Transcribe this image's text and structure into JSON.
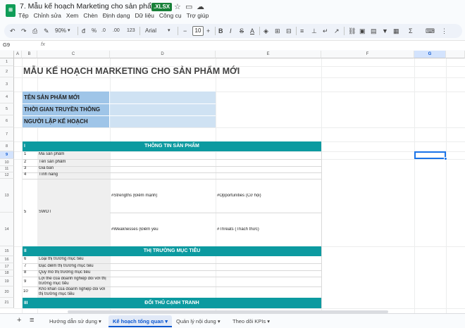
{
  "window": {
    "title": "7. Mẫu kế hoạch Marketing cho sản phẩm mới",
    "file_badge": ".XLSX",
    "menu": [
      "Tệp",
      "Chỉnh sửa",
      "Xem",
      "Chèn",
      "Định dạng",
      "Dữ liệu",
      "Công cụ",
      "Trợ giúp"
    ]
  },
  "toolbar": {
    "zoom": "90%",
    "percent": "%",
    "decimal_less": ".0",
    "decimal_more": ".00",
    "number_format": "123",
    "font_name": "Arial",
    "font_size": "10",
    "bold": "B",
    "italic": "I",
    "strike": "S",
    "text_color": "A"
  },
  "formula_bar": {
    "name_box": "G9",
    "fx": "fx"
  },
  "columns": [
    "A",
    "B",
    "C",
    "D",
    "E",
    "F",
    "G"
  ],
  "rows": [
    "1",
    "2",
    "3",
    "4",
    "5",
    "6",
    "7",
    "8",
    "9",
    "10",
    "11",
    "12",
    "13",
    "14",
    "15",
    "16",
    "17",
    "18",
    "19",
    "20",
    "21"
  ],
  "selected_cell": {
    "column": "G",
    "row": "9"
  },
  "sheet": {
    "main_title": "MẪU KẾ HOẠCH MARKETING CHO SẢN PHẨM MỚI",
    "info_labels": [
      "TÊN SẢN PHẨM MỚI",
      "THỜI GIAN TRUYỀN THÔNG",
      "NGƯỜI LẬP KẾ HOẠCH"
    ],
    "section1": {
      "index": "I",
      "header": "THÔNG TIN SẢN PHẨM",
      "items": [
        {
          "no": "1",
          "label": "Mã sản phẩm"
        },
        {
          "no": "2",
          "label": "Tên sản phẩm"
        },
        {
          "no": "3",
          "label": "Giá bán"
        },
        {
          "no": "4",
          "label": "Tính năng"
        },
        {
          "no": "5",
          "label": "SWOT"
        }
      ],
      "swot": {
        "strengths": "#Strengths (Điểm mạnh)",
        "opportunities": "#Opportunities (Cơ hội)",
        "weaknesses": "#Weaknesses (Điểm yếu",
        "threats": "#Threats (Thách thức)"
      }
    },
    "section2": {
      "index": "II",
      "header": "THỊ TRƯỜNG MỤC TIÊU",
      "items": [
        {
          "no": "6",
          "label": "Loại thị trường mục tiêu"
        },
        {
          "no": "7",
          "label": "Đặc điểm thị trường mục tiêu"
        },
        {
          "no": "8",
          "label": "Quy mô thị trường mục tiêu"
        },
        {
          "no": "9",
          "label": "Lợi thế của doanh nghiệp đối với thị trường mục tiêu"
        },
        {
          "no": "10",
          "label": "Khó khăn của doanh nghiệp đối với thị trường mục tiêu"
        }
      ]
    },
    "section3": {
      "index": "III",
      "header": "ĐỐI THỦ CẠNH TRANH"
    }
  },
  "sheet_tabs": [
    {
      "label": "Hướng dẫn sử dụng",
      "active": false
    },
    {
      "label": "Kế hoạch tổng quan",
      "active": true
    },
    {
      "label": "Quản lý nội dung",
      "active": false
    },
    {
      "label": "Theo dõi KPIs",
      "active": false
    }
  ],
  "colors": {
    "teal_header": "#0c9aa0",
    "info_label_bg": "#9fc5e8",
    "info_value_bg": "#cfe2f3",
    "selection": "#1a73e8"
  }
}
